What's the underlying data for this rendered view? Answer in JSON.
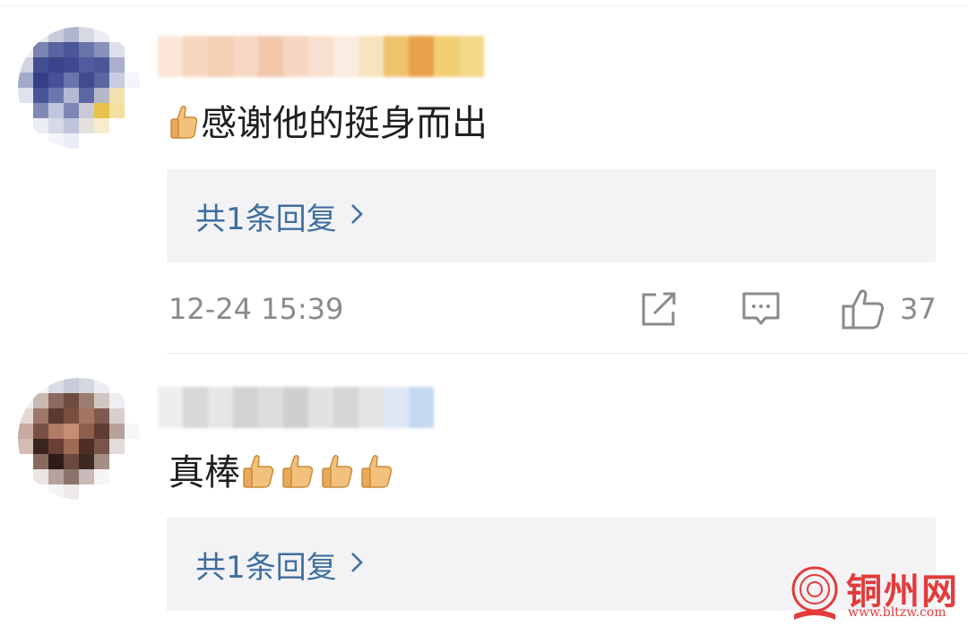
{
  "comments": [
    {
      "text": "感谢他的挺身而出",
      "reply_label": "共1条回复",
      "time": "12-24 15:39",
      "likes": "37",
      "actions": [
        "share-icon",
        "comment-icon",
        "thumbs-up-icon"
      ]
    },
    {
      "text": "真棒",
      "reply_label": "共1条回复"
    }
  ],
  "watermark": {
    "name": "铜州网",
    "url": "www.bltzw.com"
  },
  "colors": {
    "reply_link": "#3f6fa0",
    "meta_text": "#8a8a8a",
    "reply_bg": "#f3f3f5",
    "watermark": "#e23b3b"
  }
}
